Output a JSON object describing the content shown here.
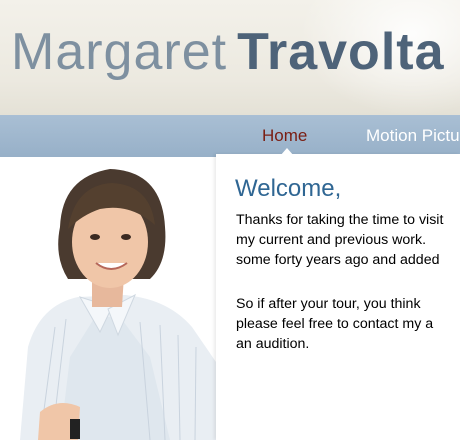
{
  "header": {
    "title_first": "Margaret",
    "title_last": "Travolta"
  },
  "nav": {
    "items": [
      {
        "label": "Home",
        "active": true
      },
      {
        "label": "Motion Pictures",
        "active": false
      }
    ]
  },
  "content": {
    "heading": "Welcome,",
    "paragraph1": [
      "Thanks for taking the time to visit",
      "my current and previous work.",
      "some forty years ago and added"
    ],
    "paragraph2": [
      "So if after your tour, you think",
      "please feel free to contact my a",
      "an audition."
    ]
  },
  "colors": {
    "nav_bar": "#9fb6cd",
    "nav_active": "#7a1d12",
    "heading": "#2f6693",
    "title_light": "#7e90a0",
    "title_dark": "#4e6379"
  }
}
